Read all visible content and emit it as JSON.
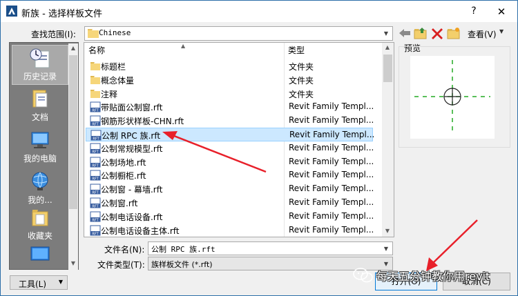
{
  "window": {
    "title": "新族 - 选择样板文件",
    "help_glyph": "?",
    "close_glyph": "✕"
  },
  "toolbar": {
    "look_in_label": "查找范围(I):",
    "look_in_value": "Chinese",
    "view_label": "查看(V)",
    "icons": [
      "back-arrow-icon",
      "up-folder-icon",
      "delete-icon",
      "new-folder-icon"
    ]
  },
  "places": [
    {
      "label": "历史记录",
      "icon": "history-icon",
      "selected": true
    },
    {
      "label": "文档",
      "icon": "documents-icon",
      "selected": false
    },
    {
      "label": "我的电脑",
      "icon": "computer-icon",
      "selected": false
    },
    {
      "label": "我的...",
      "icon": "network-icon",
      "selected": false
    },
    {
      "label": "收藏夹",
      "icon": "favorites-icon",
      "selected": false
    },
    {
      "label": "",
      "icon": "desktop-icon",
      "selected": false
    }
  ],
  "filelist": {
    "columns": {
      "name": "名称",
      "type": "类型"
    },
    "rows": [
      {
        "name": "标题栏",
        "type": "文件夹",
        "kind": "folder"
      },
      {
        "name": "概念体量",
        "type": "文件夹",
        "kind": "folder"
      },
      {
        "name": "注释",
        "type": "文件夹",
        "kind": "folder"
      },
      {
        "name": "带贴面公制窗.rft",
        "type": "Revit Family Templ...",
        "kind": "rft"
      },
      {
        "name": "钢筋形状样板-CHN.rft",
        "type": "Revit Family Templ...",
        "kind": "rft"
      },
      {
        "name": "公制 RPC 族.rft",
        "type": "Revit Family Templ...",
        "kind": "rft",
        "selected": true
      },
      {
        "name": "公制常规模型.rft",
        "type": "Revit Family Templ...",
        "kind": "rft"
      },
      {
        "name": "公制场地.rft",
        "type": "Revit Family Templ...",
        "kind": "rft"
      },
      {
        "name": "公制橱柜.rft",
        "type": "Revit Family Templ...",
        "kind": "rft"
      },
      {
        "name": "公制窗 - 幕墙.rft",
        "type": "Revit Family Templ...",
        "kind": "rft"
      },
      {
        "name": "公制窗.rft",
        "type": "Revit Family Templ...",
        "kind": "rft"
      },
      {
        "name": "公制电话设备.rft",
        "type": "Revit Family Templ...",
        "kind": "rft"
      },
      {
        "name": "公制电话设备主体.rft",
        "type": "Revit Family Templ...",
        "kind": "rft"
      }
    ],
    "rft_badge": "RFT"
  },
  "preview": {
    "label": "预览"
  },
  "filename": {
    "label": "文件名(N):",
    "value": "公制 RPC 族.rft"
  },
  "filetype": {
    "label": "文件类型(T):",
    "value": "族样板文件 (*.rft)"
  },
  "buttons": {
    "tools": "工具(L)",
    "open": "打开(O)",
    "cancel": "取消(C)"
  },
  "watermark": {
    "text": "每天五分钟教你用revit"
  },
  "colors": {
    "selection": "#cce8ff",
    "accent": "#0078d7",
    "annotation_arrow": "#e8202a",
    "preview_line": "#22aa22"
  }
}
